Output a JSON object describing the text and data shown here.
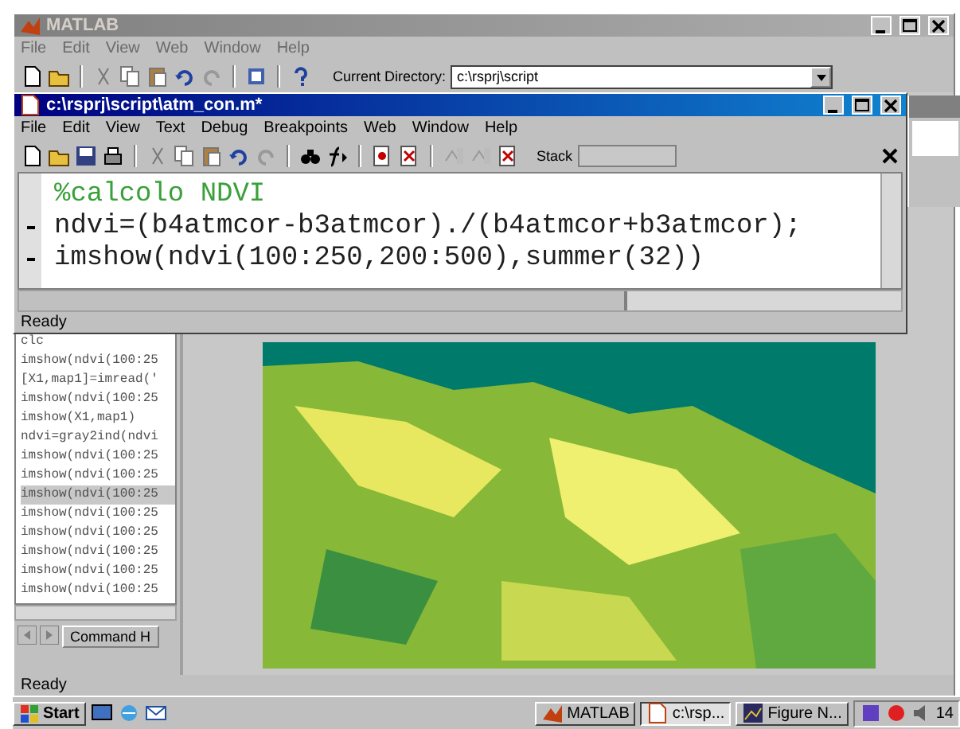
{
  "main_window": {
    "title": "MATLAB",
    "active": false,
    "menu": [
      "File",
      "Edit",
      "View",
      "Web",
      "Window",
      "Help"
    ],
    "current_directory_label": "Current Directory:",
    "current_directory": "c:\\rsprj\\script",
    "status": "Ready"
  },
  "editor": {
    "title": "c:\\rsprj\\script\\atm_con.m*",
    "active": true,
    "menu": [
      "File",
      "Edit",
      "View",
      "Text",
      "Debug",
      "Breakpoints",
      "Web",
      "Window",
      "Help"
    ],
    "stack_label": "Stack",
    "lines": [
      {
        "kind": "comment",
        "text": "%calcolo NDVI",
        "executable": false
      },
      {
        "kind": "code",
        "text": "ndvi=(b4atmcor-b3atmcor)./(b4atmcor+b3atmcor);",
        "executable": true
      },
      {
        "kind": "code",
        "text": "imshow(ndvi(100:250,200:500),summer(32))",
        "executable": true
      }
    ],
    "status": "Ready"
  },
  "command_history": {
    "items": [
      {
        "text": "clc",
        "selected": false
      },
      {
        "text": "imshow(ndvi(100:25",
        "selected": false
      },
      {
        "text": "[X1,map1]=imread('",
        "selected": false
      },
      {
        "text": "imshow(ndvi(100:25",
        "selected": false
      },
      {
        "text": "imshow(X1,map1)",
        "selected": false
      },
      {
        "text": "ndvi=gray2ind(ndvi",
        "selected": false
      },
      {
        "text": "imshow(ndvi(100:25",
        "selected": false
      },
      {
        "text": "imshow(ndvi(100:25",
        "selected": false
      },
      {
        "text": "imshow(ndvi(100:25",
        "selected": true
      },
      {
        "text": "imshow(ndvi(100:25",
        "selected": false
      },
      {
        "text": "imshow(ndvi(100:25",
        "selected": false
      },
      {
        "text": "imshow(ndvi(100:25",
        "selected": false
      },
      {
        "text": "imshow(ndvi(100:25",
        "selected": false
      },
      {
        "text": "imshow(ndvi(100:25",
        "selected": false
      }
    ],
    "tab": "Command H"
  },
  "taskbar": {
    "start": "Start",
    "buttons": [
      {
        "label": "MATLAB",
        "selected": false
      },
      {
        "label": "c:\\rsp...",
        "selected": true
      },
      {
        "label": "Figure N...",
        "selected": false
      }
    ],
    "clock": "14"
  }
}
